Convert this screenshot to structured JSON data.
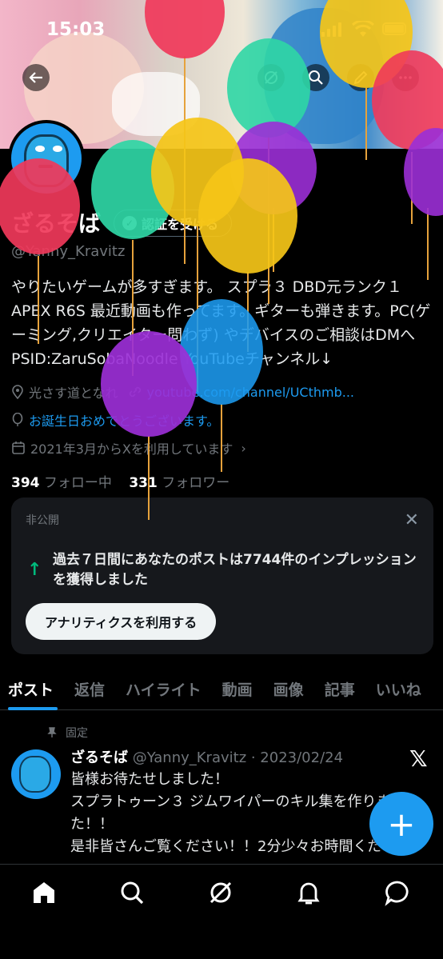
{
  "status_bar": {
    "time": "15:03"
  },
  "profile": {
    "name": "ざるそば",
    "verify_label": "認証を受ける",
    "handle": "@Yanny_Kravitz",
    "bio": "やりたいゲームが多すぎます。 スプラ３ DBD元ランク１ APEX R6S 最近動画も作ってます。ギターも弾きます。PC(ゲーミング,クリエイター問わず) やデバイスのご相談はDMへ PSID:ZaruSobaNoodle YouTubeチャンネル↓",
    "location": "光さす道となれ",
    "website": "youtube.com/channel/UCthmb...",
    "birthday": "お誕生日おめでとうございます。",
    "joined": "2021年3月からXを利用しています",
    "following_count": "394",
    "following_label": "フォロー中",
    "followers_count": "331",
    "followers_label": "フォロワー"
  },
  "analytics_card": {
    "label": "非公開",
    "message": "過去７日間にあなたのポストは7744件のインプレッションを獲得しました",
    "button": "アナリティクスを利用する"
  },
  "tabs": [
    "ポスト",
    "返信",
    "ハイライト",
    "動画",
    "画像",
    "記事",
    "いいね"
  ],
  "pinned_post": {
    "pinned_label": "固定",
    "author": "ざるそば",
    "handle_date": "@Yanny_Kravitz · 2023/02/24",
    "text_lines": [
      "皆様お待たせしました！",
      "スプラトゥーン３ ジムワイパーのキル集を作りました！！",
      "是非皆さんご覧ください！！2分少々お時間ください！"
    ]
  },
  "fab_label": "+",
  "icons": {
    "back": "back-arrow-icon",
    "grok": "grok-icon",
    "search": "search-icon",
    "compose": "edit-icon",
    "more": "more-icon",
    "location": "location-icon",
    "link": "link-icon",
    "birthday": "balloon-icon",
    "calendar": "calendar-icon",
    "home": "home-icon",
    "explore": "search-icon",
    "grok_nav": "grok-icon",
    "notifications": "bell-icon",
    "messages": "chat-icon"
  },
  "colors": {
    "accent": "#1d9bf0",
    "success": "#00ba7c",
    "background": "#000000",
    "muted": "#71767b"
  }
}
